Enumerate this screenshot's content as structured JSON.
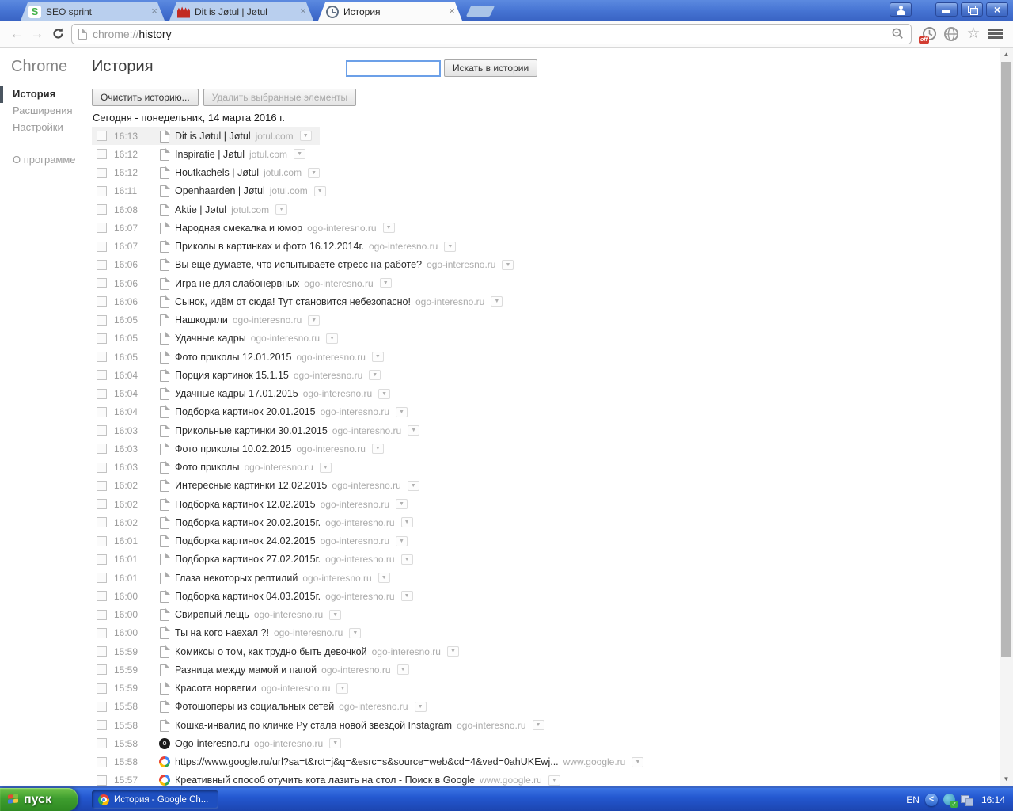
{
  "window": {
    "tabs": [
      {
        "title": "SEO sprint",
        "favicon": "seo-sprint-favicon"
      },
      {
        "title": "Dit is Jøtul | Jøtul",
        "favicon": "jotul-favicon"
      },
      {
        "title": "История",
        "favicon": "history-clock-icon"
      }
    ],
    "close_glyph": "×"
  },
  "toolbar": {
    "url_scheme": "chrome://",
    "url_path": "history"
  },
  "sidebar": {
    "title": "Chrome",
    "items": [
      {
        "label": "История",
        "active": true
      },
      {
        "label": "Расширения"
      },
      {
        "label": "Настройки"
      },
      {
        "label": "О программе"
      }
    ]
  },
  "main": {
    "title": "История",
    "search": {
      "value": "",
      "button_label": "Искать в истории"
    },
    "actions": {
      "clear_label": "Очистить историю...",
      "remove_label": "Удалить выбранные элементы"
    },
    "date_header": "Сегодня - понедельник, 14 марта 2016 г.",
    "entries": [
      {
        "time": "16:13",
        "title": "Dit is Jøtul | Jøtul",
        "domain": "jotul.com",
        "favicon": "page",
        "highlighted": true
      },
      {
        "time": "16:12",
        "title": "Inspiratie | Jøtul",
        "domain": "jotul.com",
        "favicon": "page"
      },
      {
        "time": "16:12",
        "title": "Houtkachels | Jøtul",
        "domain": "jotul.com",
        "favicon": "page"
      },
      {
        "time": "16:11",
        "title": "Openhaarden | Jøtul",
        "domain": "jotul.com",
        "favicon": "page"
      },
      {
        "time": "16:08",
        "title": "Aktie | Jøtul",
        "domain": "jotul.com",
        "favicon": "page"
      },
      {
        "time": "16:07",
        "title": "Народная смекалка и юмор",
        "domain": "ogo-interesno.ru",
        "favicon": "page"
      },
      {
        "time": "16:07",
        "title": "Приколы в картинках и фото 16.12.2014г.",
        "domain": "ogo-interesno.ru",
        "favicon": "page"
      },
      {
        "time": "16:06",
        "title": "Вы ещё думаете, что испытываете стресс на работе?",
        "domain": "ogo-interesno.ru",
        "favicon": "page"
      },
      {
        "time": "16:06",
        "title": "Игра не для слабонервных",
        "domain": "ogo-interesno.ru",
        "favicon": "page"
      },
      {
        "time": "16:06",
        "title": "Сынок, идём от сюда! Тут становится небезопасно!",
        "domain": "ogo-interesno.ru",
        "favicon": "page"
      },
      {
        "time": "16:05",
        "title": "Нашкодили",
        "domain": "ogo-interesno.ru",
        "favicon": "page"
      },
      {
        "time": "16:05",
        "title": "Удачные кадры",
        "domain": "ogo-interesno.ru",
        "favicon": "page"
      },
      {
        "time": "16:05",
        "title": "Фото приколы 12.01.2015",
        "domain": "ogo-interesno.ru",
        "favicon": "page"
      },
      {
        "time": "16:04",
        "title": "Порция картинок 15.1.15",
        "domain": "ogo-interesno.ru",
        "favicon": "page"
      },
      {
        "time": "16:04",
        "title": "Удачные кадры 17.01.2015",
        "domain": "ogo-interesno.ru",
        "favicon": "page"
      },
      {
        "time": "16:04",
        "title": "Подборка картинок 20.01.2015",
        "domain": "ogo-interesno.ru",
        "favicon": "page"
      },
      {
        "time": "16:03",
        "title": "Прикольные картинки 30.01.2015",
        "domain": "ogo-interesno.ru",
        "favicon": "page"
      },
      {
        "time": "16:03",
        "title": "Фото приколы 10.02.2015",
        "domain": "ogo-interesno.ru",
        "favicon": "page"
      },
      {
        "time": "16:03",
        "title": "Фото приколы",
        "domain": "ogo-interesno.ru",
        "favicon": "page"
      },
      {
        "time": "16:02",
        "title": "Интересные картинки 12.02.2015",
        "domain": "ogo-interesno.ru",
        "favicon": "page"
      },
      {
        "time": "16:02",
        "title": "Подборка картинок 12.02.2015",
        "domain": "ogo-interesno.ru",
        "favicon": "page"
      },
      {
        "time": "16:02",
        "title": "Подборка картинок 20.02.2015г.",
        "domain": "ogo-interesno.ru",
        "favicon": "page"
      },
      {
        "time": "16:01",
        "title": "Подборка картинок 24.02.2015",
        "domain": "ogo-interesno.ru",
        "favicon": "page"
      },
      {
        "time": "16:01",
        "title": "Подборка картинок 27.02.2015г.",
        "domain": "ogo-interesno.ru",
        "favicon": "page"
      },
      {
        "time": "16:01",
        "title": "Глаза некоторых рептилий",
        "domain": "ogo-interesno.ru",
        "favicon": "page"
      },
      {
        "time": "16:00",
        "title": "Подборка картинок 04.03.2015г.",
        "domain": "ogo-interesno.ru",
        "favicon": "page"
      },
      {
        "time": "16:00",
        "title": "Свирепый лещь",
        "domain": "ogo-interesno.ru",
        "favicon": "page"
      },
      {
        "time": "16:00",
        "title": "Ты на кого наехал ?!",
        "domain": "ogo-interesno.ru",
        "favicon": "page"
      },
      {
        "time": "15:59",
        "title": "Комиксы о том, как трудно быть девочкой",
        "domain": "ogo-interesno.ru",
        "favicon": "page"
      },
      {
        "time": "15:59",
        "title": "Разница между мамой и папой",
        "domain": "ogo-interesno.ru",
        "favicon": "page"
      },
      {
        "time": "15:59",
        "title": "Красота норвегии",
        "domain": "ogo-interesno.ru",
        "favicon": "page"
      },
      {
        "time": "15:58",
        "title": "Фотошоперы из социальных сетей",
        "domain": "ogo-interesno.ru",
        "favicon": "page"
      },
      {
        "time": "15:58",
        "title": "Кошка-инвалид по кличке Ру стала новой звездой Instagram",
        "domain": "ogo-interesno.ru",
        "favicon": "page"
      },
      {
        "time": "15:58",
        "title": "Ogo-interesno.ru",
        "domain": "ogo-interesno.ru",
        "favicon": "ogo"
      },
      {
        "time": "15:58",
        "title": "https://www.google.ru/url?sa=t&rct=j&q=&esrc=s&source=web&cd=4&ved=0ahUKEwj...",
        "domain": "www.google.ru",
        "favicon": "google"
      },
      {
        "time": "15:57",
        "title": "Креативный способ отучить кота лазить на стол - Поиск в Google",
        "domain": "www.google.ru",
        "favicon": "google"
      }
    ],
    "menu_glyph": "▼"
  },
  "taskbar": {
    "start_label": "пуск",
    "task_label": "История - Google Ch...",
    "language": "EN",
    "time": "16:14"
  },
  "colors": {
    "titlebar_blue": "#4573d2",
    "inactive_tab": "#b9cfee",
    "taskbar_blue": "#2458d0",
    "start_green": "#3f9e2f",
    "accent_focus": "#6ca0e8",
    "active_item_bar": "#4a5560"
  }
}
